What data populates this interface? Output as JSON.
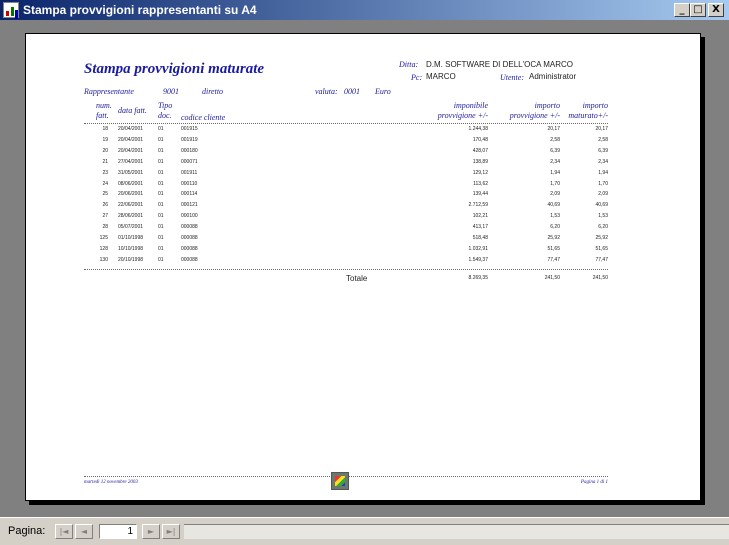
{
  "window": {
    "title": "Stampa provvigioni rappresentanti su A4",
    "minimize_glyph": "_",
    "maximize_glyph": "□",
    "close_glyph": "X"
  },
  "report": {
    "title": "Stampa provvigioni maturate",
    "ditta_label": "Ditta:",
    "ditta_value": "D.M. SOFTWARE DI DELL'OCA MARCO",
    "pc_label": "Pc:",
    "pc_value": "MARCO",
    "utente_label": "Utente:",
    "utente_value": "Administrator",
    "rappresentante_label": "Rappresentante",
    "rappresentante_code": "9001",
    "rappresentante_name": "diretto",
    "valuta_label": "valuta:",
    "valuta_code": "0001",
    "valuta_name": "Euro",
    "columns": {
      "num_fatt_1": "num.",
      "num_fatt_2": "fatt.",
      "data_fatt": "data fatt.",
      "tipo_doc_1": "Tipo",
      "tipo_doc_2": "doc.",
      "codice_cliente": "codice cliente",
      "imponibile_1": "imponibile",
      "imponibile_2": "provvigione +/-",
      "importo_1": "importo",
      "importo_2": "provvigione +/-",
      "maturato_1": "importo",
      "maturato_2": "maturato+/-"
    },
    "rows": [
      {
        "num": "18",
        "data": "20/04/2001",
        "tipo": "01",
        "cliente": "001915",
        "imponibile": "1.244,38",
        "provvigione": "20,17",
        "maturato": "20,17"
      },
      {
        "num": "19",
        "data": "20/04/2001",
        "tipo": "01",
        "cliente": "001919",
        "imponibile": "170,48",
        "provvigione": "2,58",
        "maturato": "2,58"
      },
      {
        "num": "20",
        "data": "20/04/2001",
        "tipo": "01",
        "cliente": "000180",
        "imponibile": "428,07",
        "provvigione": "6,39",
        "maturato": "6,39"
      },
      {
        "num": "21",
        "data": "27/04/2001",
        "tipo": "01",
        "cliente": "000071",
        "imponibile": "138,89",
        "provvigione": "2,34",
        "maturato": "2,34"
      },
      {
        "num": "23",
        "data": "31/05/2001",
        "tipo": "01",
        "cliente": "001911",
        "imponibile": "129,12",
        "provvigione": "1,94",
        "maturato": "1,94"
      },
      {
        "num": "24",
        "data": "08/06/2001",
        "tipo": "01",
        "cliente": "000110",
        "imponibile": "113,62",
        "provvigione": "1,70",
        "maturato": "1,70"
      },
      {
        "num": "25",
        "data": "20/06/2001",
        "tipo": "01",
        "cliente": "000114",
        "imponibile": "139,44",
        "provvigione": "2,09",
        "maturato": "2,09"
      },
      {
        "num": "26",
        "data": "22/06/2001",
        "tipo": "01",
        "cliente": "000121",
        "imponibile": "2.712,59",
        "provvigione": "40,69",
        "maturato": "40,69"
      },
      {
        "num": "27",
        "data": "28/06/2001",
        "tipo": "01",
        "cliente": "000100",
        "imponibile": "102,21",
        "provvigione": "1,53",
        "maturato": "1,53"
      },
      {
        "num": "28",
        "data": "05/07/2001",
        "tipo": "01",
        "cliente": "000088",
        "imponibile": "413,17",
        "provvigione": "6,20",
        "maturato": "6,20"
      },
      {
        "num": "125",
        "data": "01/10/1998",
        "tipo": "01",
        "cliente": "000088",
        "imponibile": "518,48",
        "provvigione": "25,92",
        "maturato": "25,92"
      },
      {
        "num": "128",
        "data": "10/10/1998",
        "tipo": "01",
        "cliente": "000088",
        "imponibile": "1.032,91",
        "provvigione": "51,65",
        "maturato": "51,65"
      },
      {
        "num": "130",
        "data": "20/10/1998",
        "tipo": "01",
        "cliente": "000088",
        "imponibile": "1.549,37",
        "provvigione": "77,47",
        "maturato": "77,47"
      }
    ],
    "totale_label": "Totale",
    "totale_imponibile": "8.269,35",
    "totale_provvigione": "241,50",
    "totale_maturato": "241,50",
    "footer_date": "martedì 12 novembre 2003",
    "footer_page": "Pagina 1 di 1"
  },
  "statusbar": {
    "page_label": "Pagina:",
    "first_glyph": "|◄",
    "prev_glyph": "◄",
    "page_value": "1",
    "next_glyph": "►",
    "last_glyph": "►|"
  }
}
